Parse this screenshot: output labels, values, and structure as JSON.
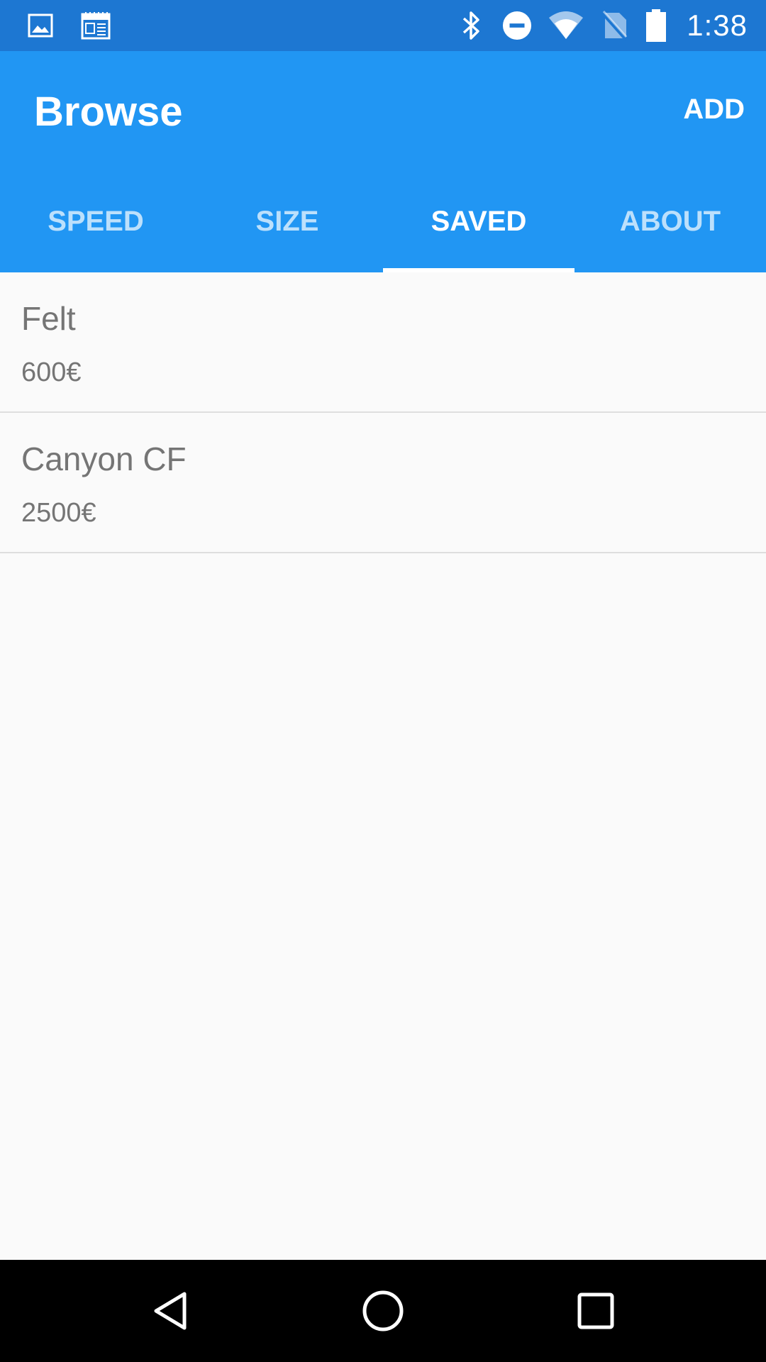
{
  "status_bar": {
    "time": "1:38",
    "icons_left": [
      "image-icon",
      "calendar-icon"
    ],
    "icons_right": [
      "bluetooth-icon",
      "do-not-disturb-icon",
      "wifi-icon",
      "no-sim-icon",
      "battery-icon"
    ]
  },
  "app_bar": {
    "title": "Browse",
    "add_label": "ADD"
  },
  "tabs": [
    {
      "label": "SPEED",
      "active": false
    },
    {
      "label": "SIZE",
      "active": false
    },
    {
      "label": "SAVED",
      "active": true
    },
    {
      "label": "ABOUT",
      "active": false
    }
  ],
  "saved_items": [
    {
      "name": "Felt",
      "price": "600€"
    },
    {
      "name": "Canyon CF",
      "price": "2500€"
    }
  ],
  "nav_bar": {
    "icons": [
      "back-icon",
      "home-icon",
      "recents-icon"
    ]
  },
  "colors": {
    "status_bar": "#1d77d2",
    "app_bar": "#2196f3",
    "background": "#fafafa",
    "item_text": "#757575"
  }
}
